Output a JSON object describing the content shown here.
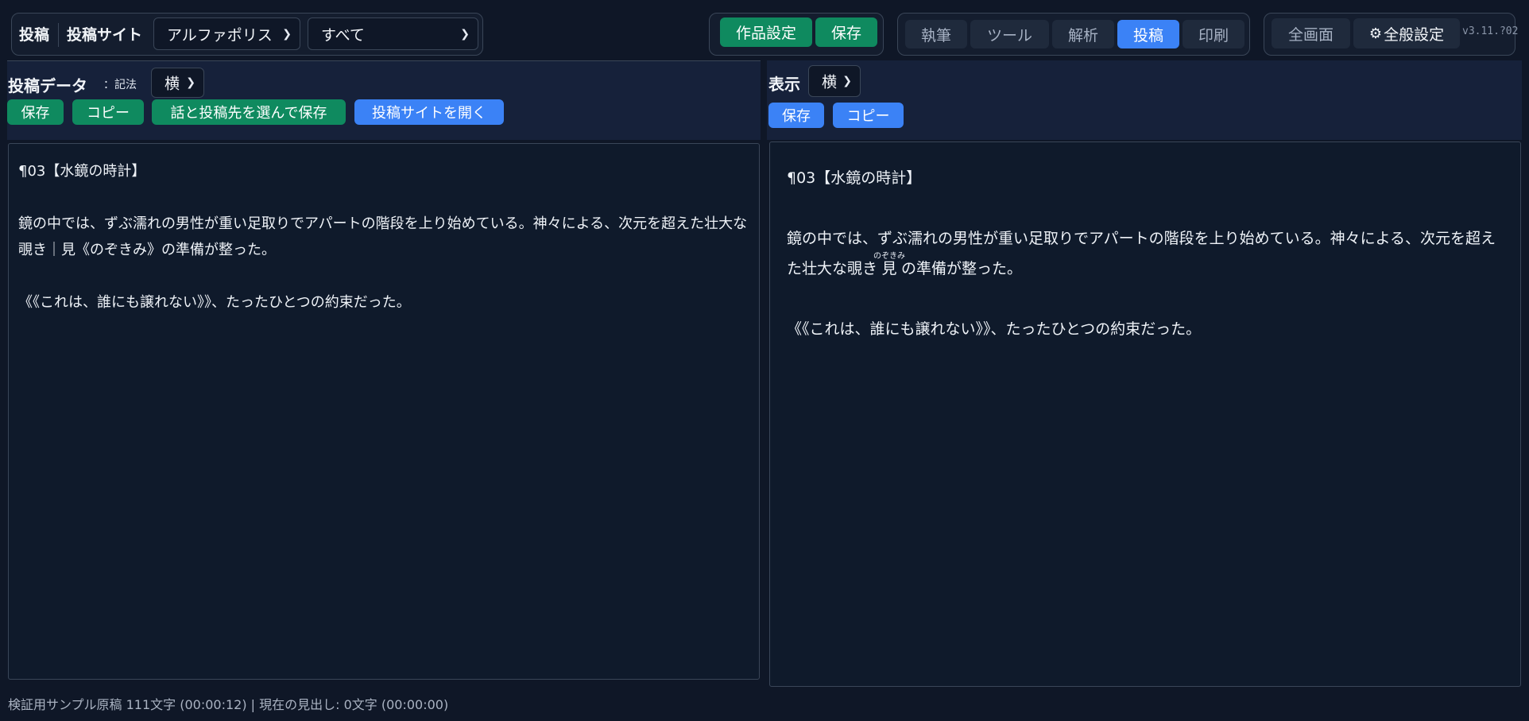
{
  "toolbar": {
    "mode_label": "投稿",
    "site_label": "投稿サイト",
    "site_select": "アルファポリス",
    "scope_select": "すべて",
    "work_settings": "作品設定",
    "save": "保存",
    "tabs": [
      {
        "label": "執筆",
        "active": false
      },
      {
        "label": "ツール",
        "active": false
      },
      {
        "label": "解析",
        "active": false
      },
      {
        "label": "投稿",
        "active": true
      },
      {
        "label": "印刷",
        "active": false
      }
    ],
    "fullscreen": "全画面",
    "settings_icon": "gear-icon",
    "settings_glyph": "⚙",
    "settings": "全般設定",
    "version": "v3.11.?02"
  },
  "left": {
    "title": "投稿データ",
    "notation_label": "：記法",
    "direction": "横",
    "buttons": {
      "save": "保存",
      "copy": "コピー",
      "save_select": "話と投稿先を選んで保存",
      "open_site": "投稿サイトを開く"
    },
    "content": {
      "heading": "¶03【水鏡の時計】",
      "para1": "鏡の中では、ずぶ濡れの男性が重い足取りでアパートの階段を上り始めている。神々による、次元を超えた壮大な覗き｜見《のぞきみ》の準備が整った。",
      "para2": "《《これは、誰にも譲れない》》、たったひとつの約束だった。"
    }
  },
  "right": {
    "title": "表示",
    "direction": "横",
    "buttons": {
      "save": "保存",
      "copy": "コピー"
    },
    "content": {
      "heading": "¶03【水鏡の時計】",
      "para1_before": "鏡の中では、ずぶ濡れの男性が重い足取りでアパートの階段を上り始めている。神々による、次元を超えた壮大な覗き",
      "ruby_base": "見",
      "ruby_text": "のぞきみ",
      "para1_after": "の準備が整った。",
      "para2": "《《これは、誰にも譲れない》》、たったひとつの約束だった。"
    }
  },
  "status": "検証用サンプル原稿 111文字 (00:00:12) | 現在の見出し: 0文字 (00:00:00)",
  "colors": {
    "background": "#0f1727",
    "green": "#0f8a5f",
    "blue": "#3b82f6"
  }
}
